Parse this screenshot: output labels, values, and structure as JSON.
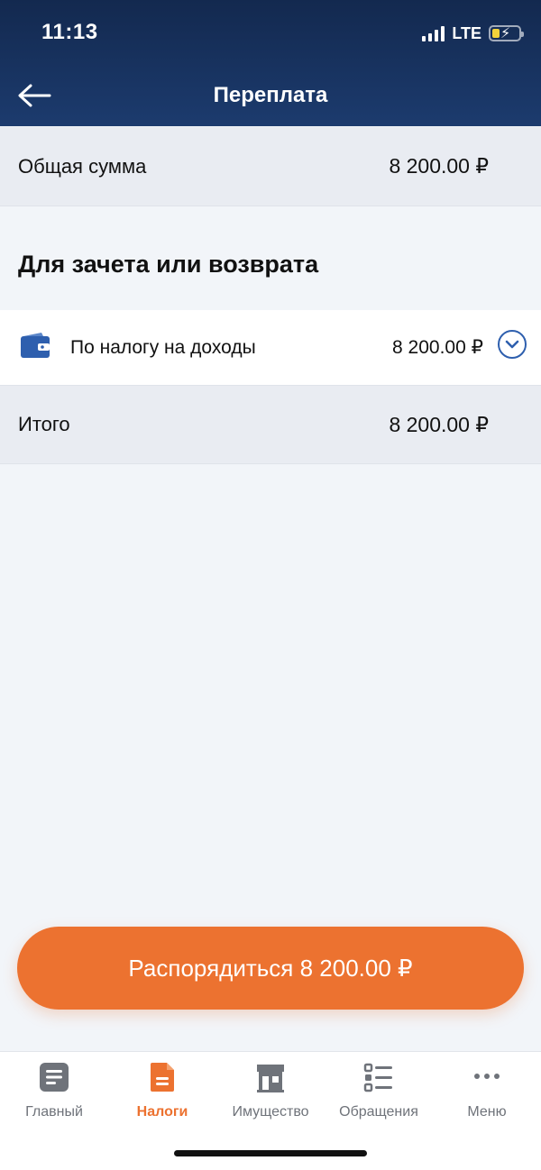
{
  "status": {
    "time": "11:13",
    "network": "LTE"
  },
  "header": {
    "title": "Переплата"
  },
  "summary": {
    "label": "Общая сумма",
    "value": "8 200.00 ₽"
  },
  "section": {
    "title": "Для зачета или возврата"
  },
  "items": [
    {
      "label": "По налогу на доходы",
      "value": "8 200.00 ₽",
      "icon": "wallet-icon"
    }
  ],
  "total": {
    "label": "Итого",
    "value": "8 200.00 ₽"
  },
  "cta": {
    "label": "Распорядиться 8 200.00 ₽"
  },
  "tabs": [
    {
      "label": "Главный",
      "icon": "document-icon",
      "active": false
    },
    {
      "label": "Налоги",
      "icon": "tax-document-icon",
      "active": true
    },
    {
      "label": "Имущество",
      "icon": "building-icon",
      "active": false
    },
    {
      "label": "Обращения",
      "icon": "list-icon",
      "active": false
    },
    {
      "label": "Меню",
      "icon": "dots-icon",
      "active": false
    }
  ],
  "colors": {
    "accent": "#ec7230",
    "header": "#1c3b6e",
    "link": "#2e5fae"
  }
}
